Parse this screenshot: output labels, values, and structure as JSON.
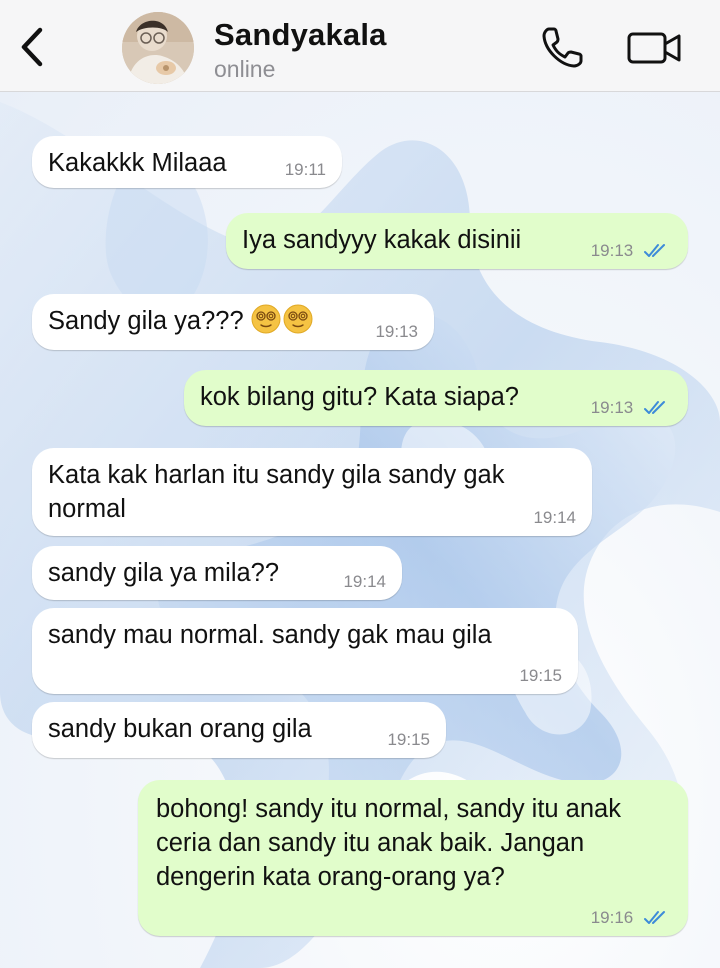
{
  "header": {
    "contact_name": "Sandyakala",
    "status": "online",
    "back_icon": "chevron-left-icon",
    "call_icon": "phone-icon",
    "video_icon": "video-camera-icon"
  },
  "colors": {
    "incoming_bubble": "#ffffff",
    "outgoing_bubble": "#e1fdcb",
    "read_ticks": "#3d8bd9",
    "timestamp": "#8a8a8e"
  },
  "messages": [
    {
      "direction": "in",
      "text": "Kakakkk Milaaa",
      "time": "19:11"
    },
    {
      "direction": "out",
      "text": "Iya sandyyy kakak disinii",
      "time": "19:13",
      "read": true
    },
    {
      "direction": "in",
      "text": "Sandy gila ya???",
      "emoji": "face-with-spiral-eyes ×2",
      "time": "19:13"
    },
    {
      "direction": "out",
      "text": "kok bilang gitu? Kata siapa?",
      "time": "19:13",
      "read": true
    },
    {
      "direction": "in",
      "text": "Kata kak harlan itu sandy gila sandy gak normal",
      "time": "19:14"
    },
    {
      "direction": "in",
      "text": "sandy gila ya mila??",
      "time": "19:14"
    },
    {
      "direction": "in",
      "text": "sandy mau normal. sandy gak mau gila",
      "time": "19:15"
    },
    {
      "direction": "in",
      "text": "sandy bukan orang gila",
      "time": "19:15"
    },
    {
      "direction": "out",
      "text": "bohong! sandy itu normal, sandy itu anak ceria dan sandy itu anak baik. Jangan dengerin kata orang-orang ya?",
      "time": "19:16",
      "read": true
    }
  ]
}
